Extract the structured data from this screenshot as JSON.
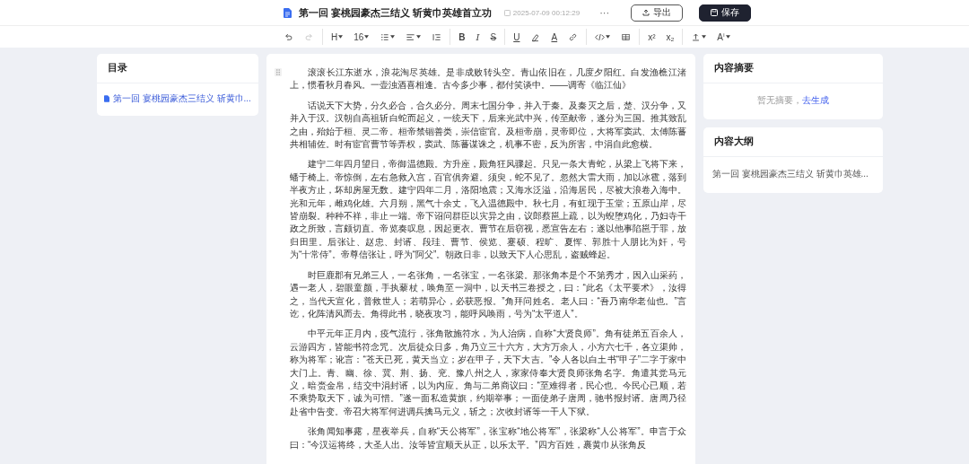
{
  "header": {
    "title": "第一回 宴桃园豪杰三结义 斩黄巾英雄首立功",
    "saved_time": "2025-07-09 00:12:29",
    "more": "···",
    "export_button": "导出",
    "save_button": "保存"
  },
  "toolbar": [
    [
      {
        "kind": "undo",
        "disabled": false,
        "dropdown": false
      },
      {
        "kind": "redo",
        "disabled": true,
        "dropdown": false
      }
    ],
    [
      {
        "kind": "text",
        "label": "H",
        "disabled": false,
        "dropdown": true
      },
      {
        "kind": "text",
        "label": "16",
        "disabled": false,
        "dropdown": true
      },
      {
        "kind": "list",
        "disabled": false,
        "dropdown": true
      },
      {
        "kind": "align",
        "disabled": false,
        "dropdown": true
      },
      {
        "kind": "indent",
        "disabled": false,
        "dropdown": false
      }
    ],
    [
      {
        "kind": "bold",
        "label": "B",
        "disabled": false,
        "dropdown": false
      },
      {
        "kind": "italic",
        "label": "I",
        "disabled": false,
        "dropdown": false
      },
      {
        "kind": "strike",
        "label": "S",
        "disabled": false,
        "dropdown": false
      }
    ],
    [
      {
        "kind": "underline",
        "label": "U",
        "disabled": false,
        "dropdown": false
      },
      {
        "kind": "highlight",
        "disabled": false,
        "dropdown": false
      },
      {
        "kind": "color",
        "label": "A",
        "disabled": false,
        "dropdown": false
      },
      {
        "kind": "link",
        "disabled": false,
        "dropdown": false
      }
    ],
    [
      {
        "kind": "code",
        "disabled": false,
        "dropdown": true
      },
      {
        "kind": "table",
        "disabled": false,
        "dropdown": false
      }
    ],
    [
      {
        "kind": "text",
        "label": "x²",
        "disabled": false,
        "dropdown": false
      },
      {
        "kind": "text",
        "label": "x₂",
        "disabled": false,
        "dropdown": false
      }
    ],
    [
      {
        "kind": "upload",
        "disabled": false,
        "dropdown": true
      },
      {
        "kind": "text",
        "label": "Aⁱ",
        "disabled": false,
        "dropdown": true
      }
    ]
  ],
  "toc": {
    "title": "目录",
    "items": [
      {
        "label": "第一回 宴桃园豪杰三结义 斩黄巾...",
        "selected": true
      }
    ]
  },
  "document": {
    "paragraphs": [
      "滚滚长江东逝水，浪花淘尽英雄。是非成败转头空。青山依旧在，几度夕阳红。白发渔樵江渚上，惯看秋月春风。一壶浊酒喜相逢。古今多少事，都付笑谈中。——调寄《临江仙》",
      "话说天下大势，分久必合，合久必分。周末七国分争，并入于秦。及秦灭之后，楚、汉分争，又并入于汉。汉朝自高祖斩白蛇而起义，一统天下，后来光武中兴，传至献帝，遂分为三国。推其致乱之由，殆始于桓、灵二帝。桓帝禁锢善类，崇信宦官。及桓帝崩，灵帝即位，大将军窦武、太傅陈蕃共相辅佐。时有宦官曹节等弄权，窦武、陈蕃谋诛之，机事不密，反为所害，中涓自此愈横。",
      "建宁二年四月望日，帝御温德殿。方升座，殿角狂风骤起。只见一条大青蛇，从梁上飞将下来，蟠于椅上。帝惊倒，左右急救入宫，百官俱奔避。须臾，蛇不见了。忽然大雷大雨，加以冰雹，落到半夜方止，坏却房屋无数。建宁四年二月，洛阳地震；又海水泛溢，沿海居民，尽被大浪卷入海中。光和元年，雌鸡化雄。六月朔，黑气十余丈，飞入温德殿中。秋七月，有虹现于玉堂；五原山岸，尽皆崩裂。种种不祥，非止一端。帝下诏问群臣以灾异之由，议郎蔡邕上疏，以为蜺堕鸡化，乃妇寺干政之所致，言颇切直。帝览奏叹息，因起更衣。曹节在后窃视，悉宣告左右；遂以他事陷邕于罪，放归田里。后张让、赵忠、封谞、段珪、曹节、侯览、蹇硕、程旷、夏恽、郭胜十人朋比为奸，号为“十常侍”。帝尊信张让，呼为“阿父”。朝政日非，以致天下人心思乱，盗贼蜂起。",
      "时巨鹿郡有兄弟三人，一名张角，一名张宝，一名张梁。那张角本是个不第秀才，因入山采药，遇一老人，碧眼童颜，手执藜杖，唤角至一洞中，以天书三卷授之，曰：“此名《太平要术》，汝得之，当代天宣化，普救世人；若萌异心，必获恶报。”角拜问姓名。老人曰：“吾乃南华老仙也。”言讫，化阵清风而去。角得此书，晓夜攻习，能呼风唤雨，号为“太平道人”。",
      "中平元年正月内，疫气流行，张角散施符水，为人治病，自称“大贤良师”。角有徒弟五百余人，云游四方，皆能书符念咒。次后徒众日多，角乃立三十六方，大方万余人，小方六七千，各立渠帅，称为将军；讹言：“苍天已死，黄天当立；岁在甲子，天下大吉。”令人各以白土书“甲子”二字于家中大门上。青、幽、徐、冀、荆、扬、兖、豫八州之人，家家侍奉大贤良师张角名字。角遣其党马元义，暗赍金帛，结交中涓封谞，以为内应。角与二弟商议曰：“至难得者，民心也。今民心已顺，若不乘势取天下，诚为可惜。”遂一面私造黄旗，约期举事；一面使弟子唐周，驰书报封谞。唐周乃径赴省中告变。帝召大将军何进调兵擒马元义，斩之；次收封谞等一干人下狱。",
      "张角闻知事露，星夜举兵，自称“天公将军”，张宝称“地公将军”，张梁称“人公将军”。申言于众曰：“今汉运将终，大圣人出。汝等皆宜顺天从正，以乐太平。”四方百姓，裹黄巾从张角反"
    ]
  },
  "summary": {
    "title": "内容摘要",
    "empty_text": "暂无摘要，",
    "generate_link": "去生成"
  },
  "outline": {
    "title": "内容大纲",
    "items": [
      "第一回 宴桃园豪杰三结义 斩黄巾英雄..."
    ]
  }
}
